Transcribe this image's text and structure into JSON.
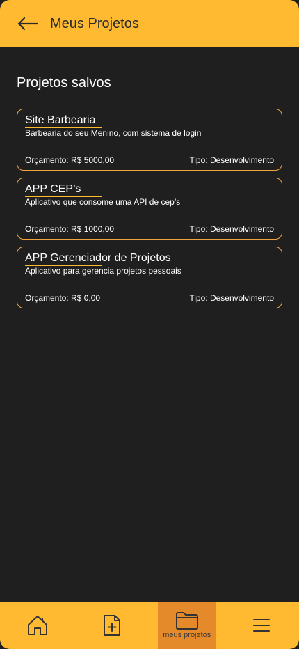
{
  "header": {
    "title": "Meus Projetos",
    "back_icon": "arrow-left-icon"
  },
  "section": {
    "title": "Projetos salvos"
  },
  "projects": [
    {
      "name": "Site Barbearia",
      "description": "Barbearia do seu Menino, com sistema de login",
      "budget": "Orçamento: R$ 5000,00",
      "type": "Tipo: Desenvolvimento"
    },
    {
      "name": "APP CEP’s",
      "description": "Aplicativo que consome uma API de cep’s",
      "budget": "Orçamento: R$ 1000,00",
      "type": "Tipo: Desenvolvimento"
    },
    {
      "name": "APP Gerenciador de Projetos",
      "description": "Aplicativo para gerencia projetos pessoais",
      "budget": "Orçamento: R$ 0,00",
      "type": "Tipo: Desenvolvimento"
    }
  ],
  "bottom_nav": {
    "items": [
      {
        "icon": "home-icon"
      },
      {
        "icon": "add-file-icon"
      },
      {
        "icon": "folder-icon",
        "label": "meus projetos"
      },
      {
        "icon": "menu-icon"
      }
    ]
  },
  "colors": {
    "accent": "#FFBA31",
    "active_tab": "#E48A2B",
    "card_border": "#F2A43A",
    "background": "#1F1F1F"
  }
}
